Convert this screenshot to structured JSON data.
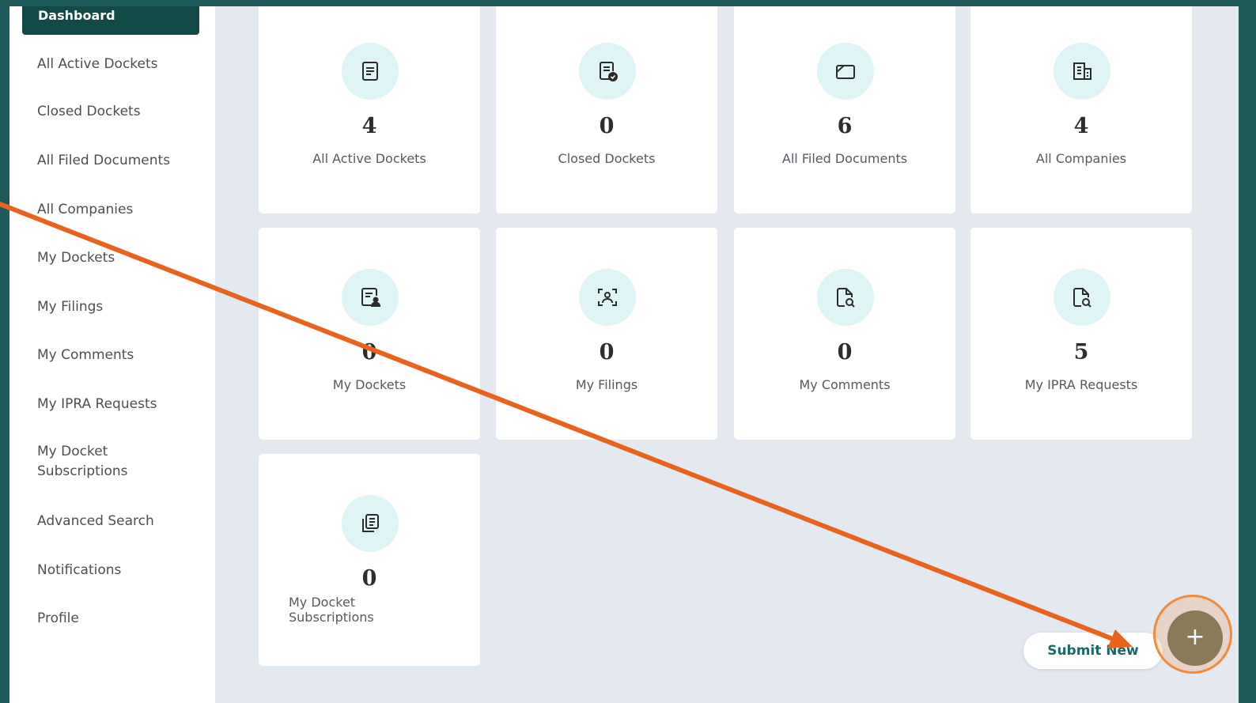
{
  "sidebar": {
    "active_item": "Dashboard",
    "items": [
      {
        "label": "All Active Dockets"
      },
      {
        "label": "Closed Dockets"
      },
      {
        "label": "All Filed Documents"
      },
      {
        "label": "All Companies"
      },
      {
        "label": "My Dockets"
      },
      {
        "label": "My Filings"
      },
      {
        "label": "My Comments"
      },
      {
        "label": "My IPRA Requests"
      },
      {
        "label": "My Docket Subscriptions",
        "line1": "My Docket",
        "line2": "Subscriptions"
      },
      {
        "label": "Advanced Search"
      },
      {
        "label": "Notifications"
      },
      {
        "label": "Profile"
      }
    ]
  },
  "cards": [
    {
      "value": "4",
      "label": "All Active Dockets",
      "icon": "document-list-icon"
    },
    {
      "value": "0",
      "label": "Closed Dockets",
      "icon": "document-check-icon"
    },
    {
      "value": "6",
      "label": "All Filed Documents",
      "icon": "folder-icon"
    },
    {
      "value": "4",
      "label": "All Companies",
      "icon": "building-icon"
    },
    {
      "value": "0",
      "label": "My Dockets",
      "icon": "document-user-icon"
    },
    {
      "value": "0",
      "label": "My Filings",
      "icon": "user-scan-icon"
    },
    {
      "value": "0",
      "label": "My Comments",
      "icon": "document-search-icon"
    },
    {
      "value": "5",
      "label": "My IPRA Requests",
      "icon": "document-search-icon"
    },
    {
      "value": "0",
      "label": "My Docket Subscriptions",
      "line1": "My Docket",
      "line2": "Subscriptions",
      "icon": "documents-stack-icon"
    }
  ],
  "submit": {
    "label": "Submit New",
    "fab_symbol": "+"
  },
  "colors": {
    "sidebar_active": "#134a47",
    "accent_teal": "#1a6766",
    "icon_circle": "#dff4f4",
    "annotation_arrow": "#e8641e",
    "fab": "#8a7a58"
  }
}
